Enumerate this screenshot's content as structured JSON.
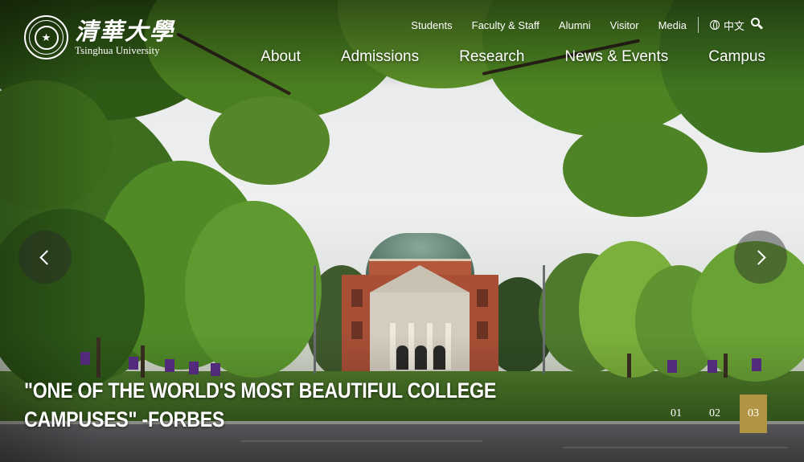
{
  "logo": {
    "chinese_name": "清華大學",
    "english_name": "Tsinghua University"
  },
  "utility_nav": {
    "links": [
      "Students",
      "Faculty & Staff",
      "Alumni",
      "Visitor",
      "Media"
    ],
    "language_label": "中文"
  },
  "main_nav": {
    "links": [
      "About",
      "Admissions",
      "Research",
      "News & Events",
      "Campus"
    ]
  },
  "hero": {
    "caption_line1": "\"ONE OF THE WORLD'S MOST BEAUTIFUL COLLEGE",
    "caption_line2": "CAMPUSES\" -FORBES"
  },
  "pager": {
    "slides": [
      "01",
      "02",
      "03"
    ],
    "active_index": 2,
    "active_color": "#b19544"
  },
  "icons": {
    "globe": "globe-icon",
    "search": "search-icon",
    "prev": "chevron-left-icon",
    "next": "chevron-right-icon"
  }
}
